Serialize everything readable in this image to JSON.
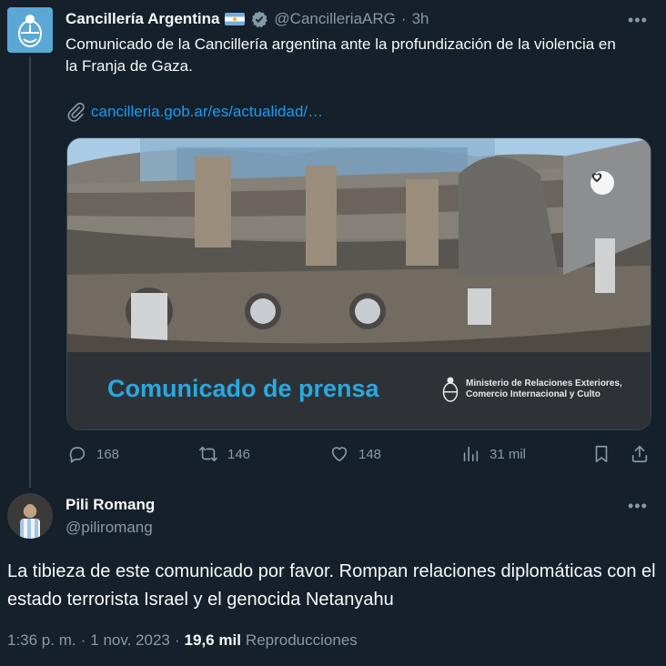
{
  "tweet1": {
    "author_name": "Cancillería Argentina",
    "handle": "@CancilleriaARG",
    "separator": "·",
    "time": "3h",
    "more": "•••",
    "text": "Comunicado de la Cancillería argentina ante la profundización de la violencia en la Franja de Gaza.",
    "link": "cancilleria.gob.ar/es/actualidad/…",
    "card": {
      "banner_text": "Comunicado de prensa",
      "ministry_line1": "Ministerio de Relaciones Exteriores,",
      "ministry_line2": "Comercio Internacional y Culto"
    },
    "actions": {
      "replies": "168",
      "retweets": "146",
      "likes": "148",
      "views": "31 mil"
    }
  },
  "tweet2": {
    "author_name": "Pili Romang",
    "handle": "@piliromang",
    "more": "•••",
    "text": "La tibieza de este comunicado por favor. Rompan relaciones diplomáticas con el estado terrorista Israel y el genocida Netanyahu",
    "meta": {
      "time": "1:36 p. m.",
      "dot1": "·",
      "date": "1 nov. 2023",
      "dot2": "·",
      "views_count": "19,6 mil",
      "views_label": "Reproducciones"
    }
  },
  "colors": {
    "background": "#15202b",
    "link": "#1d9bf0",
    "muted": "#8b98a5",
    "banner_text": "#29a8e0"
  },
  "icons": [
    "argentina-crest-icon",
    "flag-argentina-icon",
    "verified-badge-icon",
    "paperclip-icon",
    "heart-badge-icon",
    "reply-icon",
    "retweet-icon",
    "like-icon",
    "views-icon",
    "bookmark-icon",
    "share-icon",
    "more-icon"
  ]
}
